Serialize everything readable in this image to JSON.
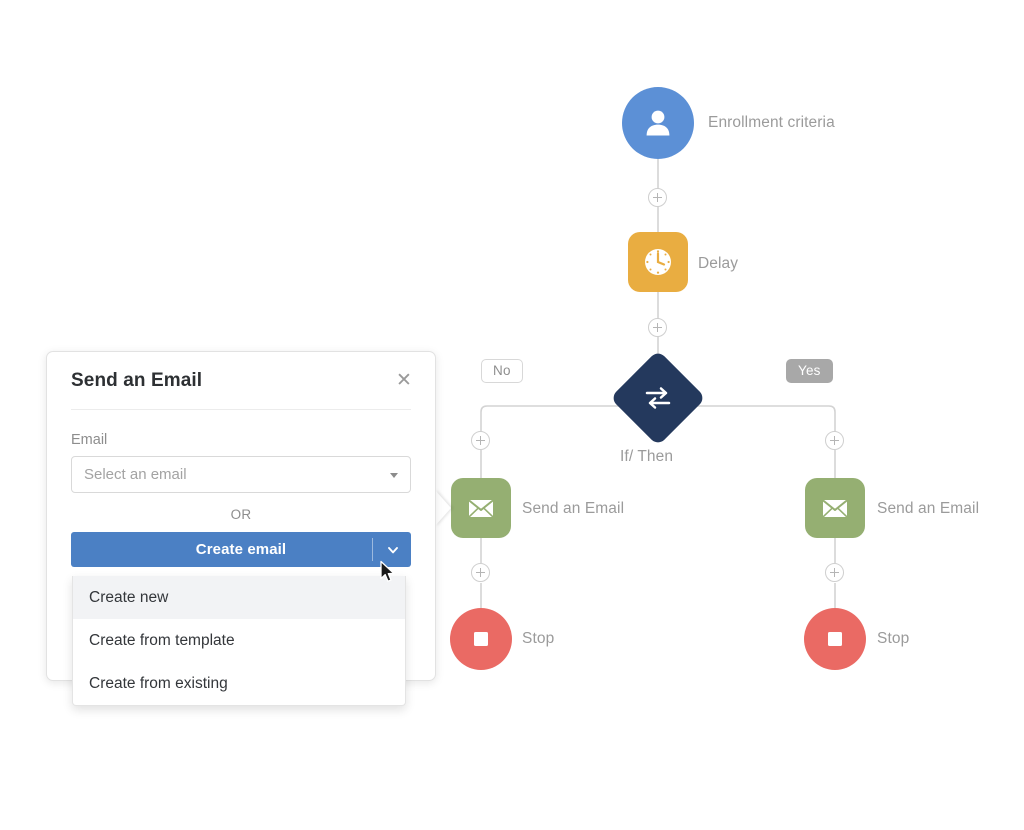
{
  "workflow": {
    "nodes": [
      {
        "id": "enrollment",
        "label": "Enrollment criteria",
        "icon": "person-icon",
        "color": "#5c90d6",
        "shape": "circle"
      },
      {
        "id": "delay",
        "label": "Delay",
        "icon": "clock-icon",
        "color": "#e9ad41",
        "shape": "rounded-square"
      },
      {
        "id": "if-then",
        "label": "If/ Then",
        "icon": "swap-arrows-icon",
        "color": "#24395d",
        "shape": "diamond"
      },
      {
        "id": "email-no",
        "label": "Send an Email",
        "icon": "envelope-icon",
        "color": "#95af72",
        "shape": "rounded-square"
      },
      {
        "id": "stop-no",
        "label": "Stop",
        "icon": "stop-square-icon",
        "color": "#ea6a64",
        "shape": "circle"
      },
      {
        "id": "email-yes",
        "label": "Send an Email",
        "icon": "envelope-icon",
        "color": "#95af72",
        "shape": "rounded-square"
      },
      {
        "id": "stop-yes",
        "label": "Stop",
        "icon": "stop-square-icon",
        "color": "#ea6a64",
        "shape": "circle"
      }
    ],
    "branches": {
      "no_label": "No",
      "yes_label": "Yes"
    },
    "add_step_icon": "plus-icon",
    "connector_color": "#d3d3d3"
  },
  "panel": {
    "title": "Send an Email",
    "close_icon": "close-icon",
    "email_label": "Email",
    "email_value": "",
    "email_placeholder": "Select an email",
    "select_caret_icon": "caret-down-icon",
    "or_label": "OR",
    "create_button_label": "Create email",
    "create_button_chevron_icon": "chevron-down-icon",
    "accent_color": "#4b80c4"
  },
  "dropdown": {
    "items": [
      {
        "label": "Create new",
        "active": true
      },
      {
        "label": "Create from template",
        "active": false
      },
      {
        "label": "Create from existing",
        "active": false
      }
    ]
  },
  "cursor": {
    "icon": "mouse-pointer-icon"
  }
}
